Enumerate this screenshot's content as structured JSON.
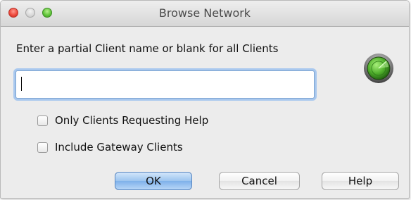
{
  "window": {
    "title": "Browse Network"
  },
  "form": {
    "prompt": "Enter a partial Client name or blank for all Clients",
    "search_value": "",
    "radar_icon": "radar-icon"
  },
  "options": [
    {
      "label": "Only Clients Requesting Help",
      "checked": false
    },
    {
      "label": "Include Gateway Clients",
      "checked": false
    }
  ],
  "buttons": {
    "ok": "OK",
    "cancel": "Cancel",
    "help": "Help"
  },
  "colors": {
    "window_bg": "#ececec",
    "accent": "#7fb1ea",
    "close": "#ee4a3d",
    "zoom": "#62c53b",
    "radar": "#4fae2b"
  }
}
